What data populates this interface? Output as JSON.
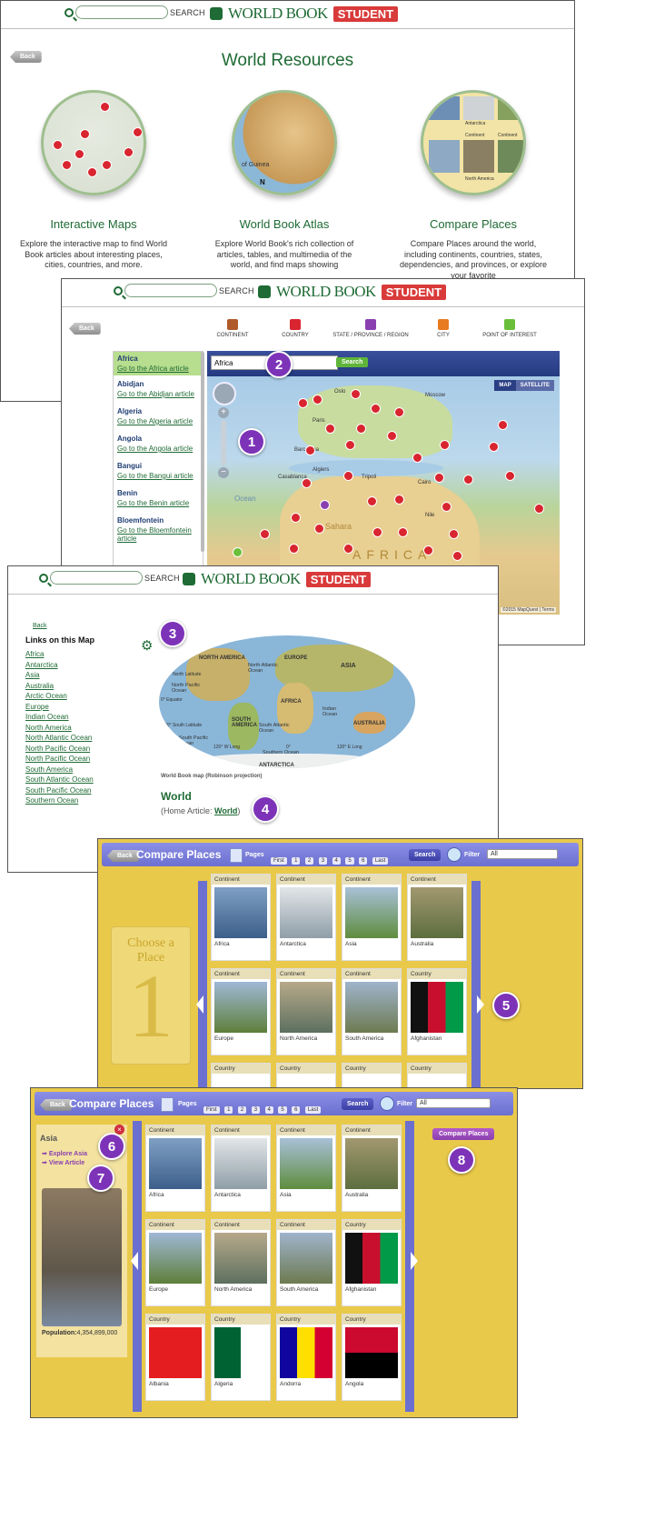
{
  "header": {
    "search_label": "SEARCH",
    "brand": "WORLD BOOK",
    "edition": "STUDENT"
  },
  "back_label": "Back",
  "world_resources": {
    "title": "World Resources",
    "items": [
      {
        "title": "Interactive Maps",
        "desc": "Explore the interactive map to find World Book articles about interesting places, cities, countries, and more."
      },
      {
        "title": "World Book Atlas",
        "desc": "Explore World Book's rich collection of articles, tables, and multimedia of the world, and find maps showing"
      },
      {
        "title": "Compare Places",
        "desc": "Compare Places around the world, including continents, countries, states, dependencies, and provinces, or explore your favorite"
      }
    ],
    "atlas_map_labels": [
      "of Guinea",
      "N"
    ],
    "compare_thumb_labels": [
      "Antarctica",
      "Continent",
      "Continent",
      "North America"
    ]
  },
  "interactive_map": {
    "categories": [
      {
        "label": "CONTINENT",
        "color": "#b05a2a"
      },
      {
        "label": "COUNTRY",
        "color": "#d8252f"
      },
      {
        "label": "STATE / PROVINCE / REGION",
        "color": "#8a3fb0"
      },
      {
        "label": "CITY",
        "color": "#e87a1f"
      },
      {
        "label": "POINT OF INTEREST",
        "color": "#6abf3a"
      }
    ],
    "sidebar": [
      {
        "name": "Africa",
        "link": "Go to the Africa article"
      },
      {
        "name": "Abidjan",
        "link": "Go to the Abidjan article"
      },
      {
        "name": "Algeria",
        "link": "Go to the Algeria article"
      },
      {
        "name": "Angola",
        "link": "Go to the Angola article"
      },
      {
        "name": "Bangui",
        "link": "Go to the Bangui article"
      },
      {
        "name": "Benin",
        "link": "Go to the Benin article"
      },
      {
        "name": "Bloemfontein",
        "link": "Go to the Bloemfontein article"
      }
    ],
    "search_value": "Africa",
    "search_button": "Search",
    "map_toggle": [
      "MAP",
      "SATELLITE"
    ],
    "place_labels": [
      "Oslo",
      "Moscow",
      "Paris",
      "Barcelona",
      "Algiers",
      "Tripoli",
      "Casablanca",
      "Cairo",
      "AFRICA",
      "Sahara",
      "Nile",
      "Ocean"
    ],
    "copyright": "©2015 MapQuest | Terms"
  },
  "atlas": {
    "links_heading": "Links on this Map",
    "links": [
      "Africa",
      "Antarctica",
      "Asia",
      "Australia",
      "Arctic Ocean",
      "Europe",
      "Indian Ocean",
      "North America",
      "North Atlantic Ocean",
      "North Pacific Ocean",
      "North Pacific Ocean",
      "South America",
      "South Atlantic Ocean",
      "South Pacific Ocean",
      "Southern Ocean"
    ],
    "map_labels": [
      "NORTH AMERICA",
      "EUROPE",
      "ASIA",
      "AFRICA",
      "SOUTH AMERICA",
      "AUSTRALIA",
      "ANTARCTICA",
      "North Atlantic Ocean",
      "North Pacific Ocean",
      "South Pacific Ocean",
      "South Atlantic Ocean",
      "Indian Ocean",
      "Southern Ocean",
      "30° North Latitude",
      "0° Equator",
      "30° South Latitude",
      "120° W Long",
      "0°",
      "120° E Long"
    ],
    "caption": "World Book map (Robinson projection)",
    "title": "World",
    "home_article_prefix": "(Home Article: ",
    "home_article_link": "World",
    "home_article_suffix": ")"
  },
  "compare": {
    "title": "Compare Places",
    "pages_label": "Pages",
    "first": "First",
    "last": "Last",
    "pages": [
      "1",
      "2",
      "3",
      "4",
      "5",
      "6"
    ],
    "search_button": "Search",
    "filter_label": "Filter",
    "filter_value": "All",
    "choose_text": "Choose a Place",
    "choose_number": "1",
    "cards": [
      {
        "type": "Continent",
        "name": "Africa"
      },
      {
        "type": "Continent",
        "name": "Antarctica"
      },
      {
        "type": "Continent",
        "name": "Asia"
      },
      {
        "type": "Continent",
        "name": "Australia"
      },
      {
        "type": "Continent",
        "name": "Europe"
      },
      {
        "type": "Continent",
        "name": "North America"
      },
      {
        "type": "Continent",
        "name": "South America"
      },
      {
        "type": "Country",
        "name": "Afghanistan"
      },
      {
        "type": "Country",
        "name": "Albania"
      },
      {
        "type": "Country",
        "name": "Algeria"
      },
      {
        "type": "Country",
        "name": "Andorra"
      },
      {
        "type": "Country",
        "name": "Angola"
      }
    ],
    "selected": {
      "name": "Asia",
      "explore": "Explore Asia",
      "view": "View Article",
      "population_label": "Population:",
      "population_value": "4,354,899,000"
    },
    "compare_button": "Compare Places"
  },
  "badges": [
    "1",
    "2",
    "3",
    "4",
    "5",
    "6",
    "7",
    "8"
  ]
}
